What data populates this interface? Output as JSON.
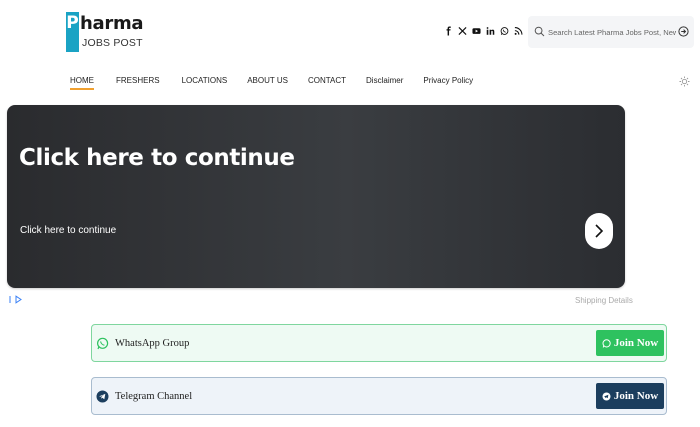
{
  "logo": {
    "letter": "P",
    "rest": "harma",
    "sub": "JOBS POST"
  },
  "social": [
    "facebook-icon",
    "x-icon",
    "youtube-icon",
    "linkedin-icon",
    "whatsapp-icon",
    "rss-icon"
  ],
  "search": {
    "placeholder": "Search Latest Pharma Jobs Post, News..."
  },
  "nav": [
    "HOME",
    "FRESHERS",
    "LOCATIONS",
    "ABOUT US",
    "CONTACT",
    "Disclaimer",
    "Privacy Policy"
  ],
  "banner": {
    "title": "Click here to continue",
    "subtitle": "Click here to continue"
  },
  "shipping": "Shipping Details",
  "whatsapp": {
    "label": "WhatsApp Group",
    "button": "Join Now"
  },
  "telegram": {
    "label": "Telegram Channel",
    "button": "Join Now"
  },
  "colors": {
    "accent": "#f0a030",
    "brand": "#1aa3c4",
    "whatsapp": "#2ec25f",
    "telegram": "#1c3e5e"
  }
}
